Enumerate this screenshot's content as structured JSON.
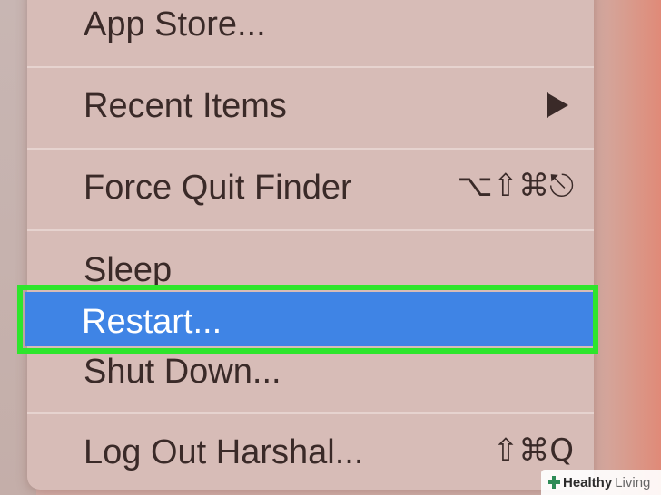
{
  "menu": {
    "items": [
      {
        "label": "App Store...",
        "shortcut": "",
        "submenu": false
      },
      {
        "label": "Recent Items",
        "shortcut": "",
        "submenu": true
      },
      {
        "label": "Force Quit Finder",
        "shortcut": "⌥⇧⌘⎋"
      },
      {
        "label": "Sleep",
        "shortcut": ""
      },
      {
        "label": "Restart...",
        "shortcut": "",
        "selected": true
      },
      {
        "label": "Shut Down...",
        "shortcut": ""
      },
      {
        "label": "Log Out Harshal...",
        "shortcut": "⇧⌘Q"
      }
    ]
  },
  "highlight_color": "#2ee52c",
  "selection_color": "#3f84e5",
  "watermark": {
    "brand_bold": "Healthy",
    "brand_light": "Living"
  }
}
